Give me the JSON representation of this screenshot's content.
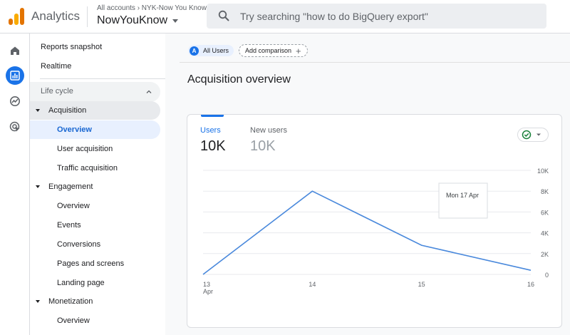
{
  "header": {
    "app_title": "Analytics",
    "account_breadcrumb": "All accounts › NYK-Now You Know",
    "property_name": "NowYouKnow",
    "search_placeholder": "Try searching \"how to do BigQuery export\""
  },
  "rail": {
    "items": [
      {
        "icon": "home-icon",
        "active": false
      },
      {
        "icon": "reports-icon",
        "active": true
      },
      {
        "icon": "explore-icon",
        "active": false
      },
      {
        "icon": "advertising-icon",
        "active": false
      }
    ]
  },
  "nav": {
    "top_items": [
      "Reports snapshot",
      "Realtime"
    ],
    "section": "Life cycle",
    "groups": [
      {
        "label": "Acquisition",
        "items": [
          "Overview",
          "User acquisition",
          "Traffic acquisition"
        ]
      },
      {
        "label": "Engagement",
        "items": [
          "Overview",
          "Events",
          "Conversions",
          "Pages and screens",
          "Landing page"
        ]
      },
      {
        "label": "Monetization",
        "items": [
          "Overview"
        ]
      }
    ],
    "active_item": "Overview"
  },
  "main": {
    "segment_chip": "All Users",
    "segment_avatar": "A",
    "add_comparison": "Add comparison",
    "page_title": "Acquisition overview",
    "card": {
      "metric1_label": "Users",
      "metric1_value": "10K",
      "metric2_label": "New users",
      "metric2_value": "10K",
      "tooltip": "Mon 17 Apr"
    }
  },
  "chart_data": {
    "type": "line",
    "x": [
      "13 Apr",
      "14",
      "15",
      "16"
    ],
    "series": [
      {
        "values": [
          0,
          8000,
          2800,
          400
        ]
      }
    ],
    "ytick_labels": [
      "10K",
      "8K",
      "6K",
      "4K",
      "2K",
      "0"
    ],
    "yticks": [
      10000,
      8000,
      6000,
      4000,
      2000,
      0
    ],
    "ylim": [
      0,
      10000
    ],
    "grid": true,
    "line_color": "#4a89dc"
  },
  "colors": {
    "accent": "#1a73e8",
    "success": "#188038"
  }
}
